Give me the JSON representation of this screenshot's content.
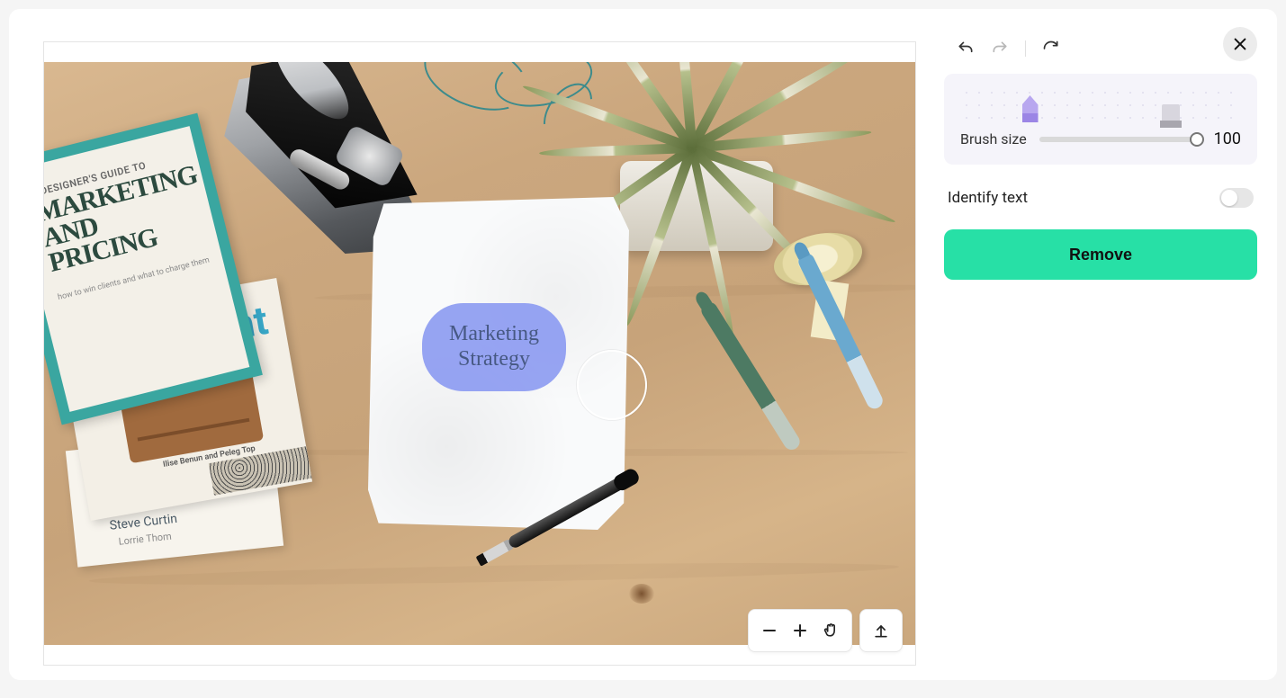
{
  "canvas": {
    "mask_text": "Marketing\nStrategy",
    "book1": {
      "tag": "E DESIGNER'S GUIDE TO",
      "title": "MARKETING\nAND PRICING",
      "sub": "how to win clients and what to charge them"
    },
    "book2": {
      "ht": "ht",
      "authors": "Ilise Benun and Peleg Top"
    },
    "book3": {
      "author": "Steve Curtin",
      "author2": "Lorrie Thom"
    }
  },
  "controls": {
    "brush_label": "Brush size",
    "brush_value": "100",
    "identify_label": "Identify text",
    "remove_label": "Remove"
  },
  "icons": {
    "undo": "undo",
    "redo": "redo",
    "reset": "reset",
    "zoom_out": "zoom-out",
    "zoom_in": "zoom-in",
    "pan": "pan-hand",
    "export": "export-up",
    "close": "close"
  }
}
